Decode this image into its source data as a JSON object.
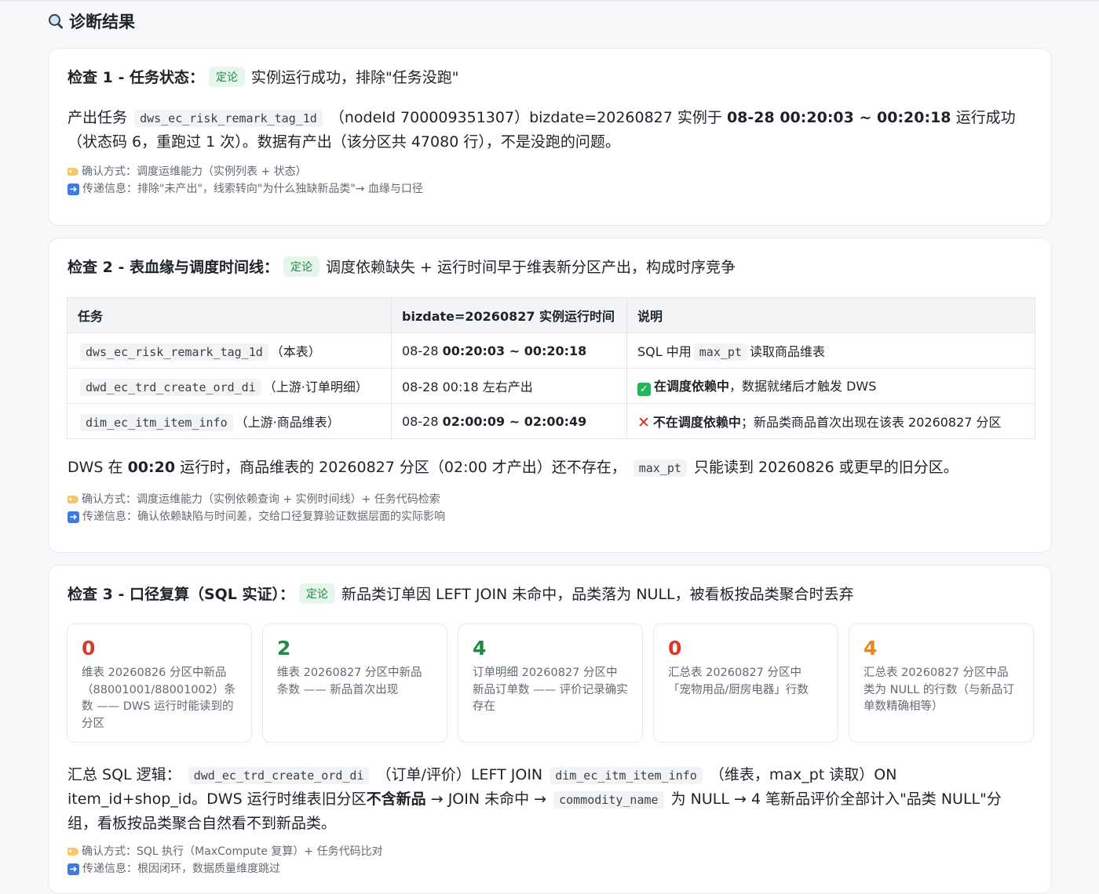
{
  "page_title": "诊断结果",
  "verdict_tag": "定论",
  "check1": {
    "title": "检查 1 - 任务状态：",
    "verdict": "实例运行成功，排除\"任务没跑\"",
    "p1": "产出任务",
    "code_task": "dws_ec_risk_remark_tag_1d",
    "p2": "（nodeId 700009351307）bizdate=20260827 实例于",
    "time_range": "08-28 00:20:03 ~ 00:20:18",
    "p3": "运行成功（状态码 6，重跑过 1 次）。数据有产出（该分区共 47080 行），不是没跑的问题。",
    "confirm": "确认方式：调度运维能力（实例列表 + 状态）",
    "pass": "传递信息：排除\"未产出\"，线索转向\"为什么独缺新品类\"→ 血缘与口径"
  },
  "check2": {
    "title": "检查 2 - 表血缘与调度时间线：",
    "verdict": "调度依赖缺失 + 运行时间早于维表新分区产出，构成时序竞争",
    "table": {
      "headers": [
        "任务",
        "bizdate=20260827 实例运行时间",
        "说明"
      ],
      "rows": [
        {
          "code": "dws_ec_risk_remark_tag_1d",
          "role": "（本表）",
          "time_pre": "08-28 ",
          "time_bold": "00:20:03 ~ 00:20:18",
          "note_pre": "SQL 中用",
          "note_code": "max_pt",
          "note_post": "读取商品维表"
        },
        {
          "code": "dwd_ec_trd_create_ord_di",
          "role": "（上游·订单明细）",
          "time_pre": "08-28 00:18 左右产出",
          "time_bold": "",
          "note_bold": "在调度依赖中",
          "note_post": "，数据就绪后才触发 DWS"
        },
        {
          "code": "dim_ec_itm_item_info",
          "role": "（上游·商品维表）",
          "time_pre": "08-28 ",
          "time_bold": "02:00:09 ~ 02:00:49",
          "note_bold": "不在调度依赖中",
          "note_post": "；新品类商品首次出现在该表 20260827 分区"
        }
      ]
    },
    "summary_pre": "DWS 在",
    "summary_bold": "00:20",
    "summary_mid": "运行时，商品维表的 20260827 分区（02:00 才产出）还不存在，",
    "summary_code": "max_pt",
    "summary_post": "只能读到 20260826 或更早的旧分区。",
    "confirm": "确认方式：调度运维能力（实例依赖查询 + 实例时间线）+ 任务代码检索",
    "pass": "传递信息：确认依赖缺陷与时间差，交给口径复算验证数据层面的实际影响"
  },
  "check3": {
    "title": "检查 3 - 口径复算（SQL 实证）：",
    "verdict": "新品类订单因 LEFT JOIN 未命中，品类落为 NULL，被看板按品类聚合时丢弃",
    "stats": [
      {
        "num": "0",
        "color": "#d83a2b",
        "desc": "维表 20260826 分区中新品（88001001/88001002）条数 —— DWS 运行时能读到的分区"
      },
      {
        "num": "2",
        "color": "#1f8a45",
        "desc": "维表 20260827 分区中新品条数 —— 新品首次出现"
      },
      {
        "num": "4",
        "color": "#1f8a45",
        "desc": "订单明细 20260827 分区中新品订单数 —— 评价记录确实存在"
      },
      {
        "num": "0",
        "color": "#d83a2b",
        "desc": "汇总表 20260827 分区中「宠物用品/厨房电器」行数"
      },
      {
        "num": "4",
        "color": "#e5891d",
        "desc": "汇总表 20260827 分区中品类为 NULL 的行数（与新品订单数精确相等）"
      }
    ],
    "s_pre": "汇总 SQL 逻辑：",
    "s_code1": "dwd_ec_trd_create_ord_di",
    "s_mid1": "（订单/评价）LEFT JOIN",
    "s_code2": "dim_ec_itm_item_info",
    "s_mid2": "（维表，max_pt 读取）ON item_id+shop_id。DWS 运行时维表旧分区",
    "s_bold": "不含新品",
    "s_mid3": "→ JOIN 未命中 →",
    "s_code3": "commodity_name",
    "s_post": "为 NULL → 4 笔新品评价全部计入\"品类 NULL\"分组，看板按品类聚合自然看不到新品类。",
    "confirm": "确认方式：SQL 执行（MaxCompute 复算）+ 任务代码比对",
    "pass": "传递信息：根因闭环，数据质量维度跳过"
  },
  "icons": [
    "magnifier-icon",
    "tag-icon",
    "arrow-right-icon",
    "check-icon",
    "cross-icon"
  ]
}
